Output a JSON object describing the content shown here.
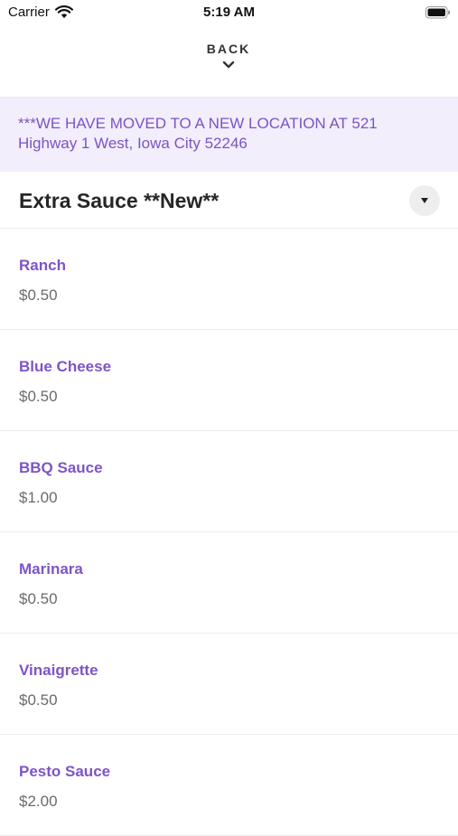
{
  "status_bar": {
    "carrier": "Carrier",
    "time": "5:19 AM",
    "icons": [
      "wifi-icon",
      "battery-icon"
    ]
  },
  "navigation": {
    "back_label": "BACK",
    "back_icon": "chevron-down-icon"
  },
  "notice": {
    "text": "***WE HAVE MOVED TO A NEW LOCATION AT 521 Highway 1 West, Iowa City 52246"
  },
  "section": {
    "title": "Extra Sauce **New**",
    "toggle_icon": "caret-down-icon"
  },
  "items": [
    {
      "name": "Ranch",
      "price": "$0.50"
    },
    {
      "name": "Blue Cheese",
      "price": "$0.50"
    },
    {
      "name": "BBQ Sauce",
      "price": "$1.00"
    },
    {
      "name": "Marinara",
      "price": "$0.50"
    },
    {
      "name": "Vinaigrette",
      "price": "$0.50"
    },
    {
      "name": "Pesto Sauce",
      "price": "$2.00"
    }
  ],
  "colors": {
    "accent": "#7e54c6",
    "notice_background": "#f3eefc",
    "notice_text": "#7a55c3",
    "price_text": "#6b6b6b"
  }
}
